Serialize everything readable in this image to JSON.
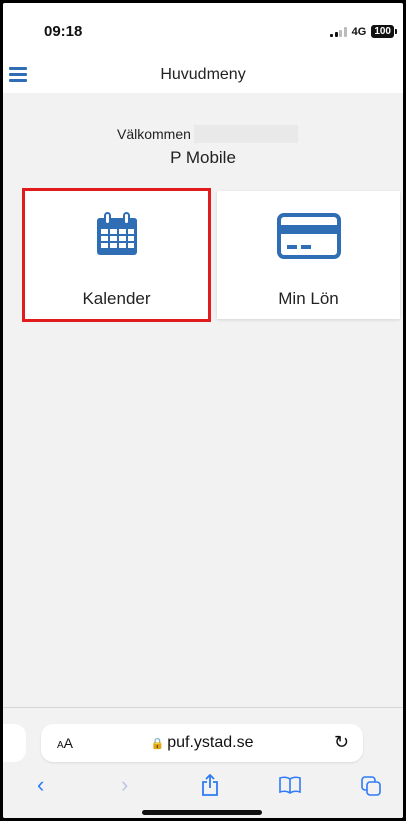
{
  "status": {
    "time": "09:18",
    "network": "4G",
    "battery": "100"
  },
  "header": {
    "title": "Huvudmeny"
  },
  "welcome": {
    "label": "Välkommen",
    "name": "P Mobile"
  },
  "tiles": [
    {
      "label": "Kalender",
      "icon": "calendar-icon"
    },
    {
      "label": "Min Lön",
      "icon": "credit-card-icon"
    }
  ],
  "browser": {
    "text_size_label_small": "A",
    "text_size_label_large": "A",
    "url": "puf.ystad.se",
    "toolbar": [
      "back-icon",
      "forward-icon",
      "share-icon",
      "bookmarks-icon",
      "tabs-icon"
    ]
  },
  "colors": {
    "accent": "#2f6eb5",
    "highlight": "#e21c1c",
    "safari_blue": "#2f7bf6"
  }
}
